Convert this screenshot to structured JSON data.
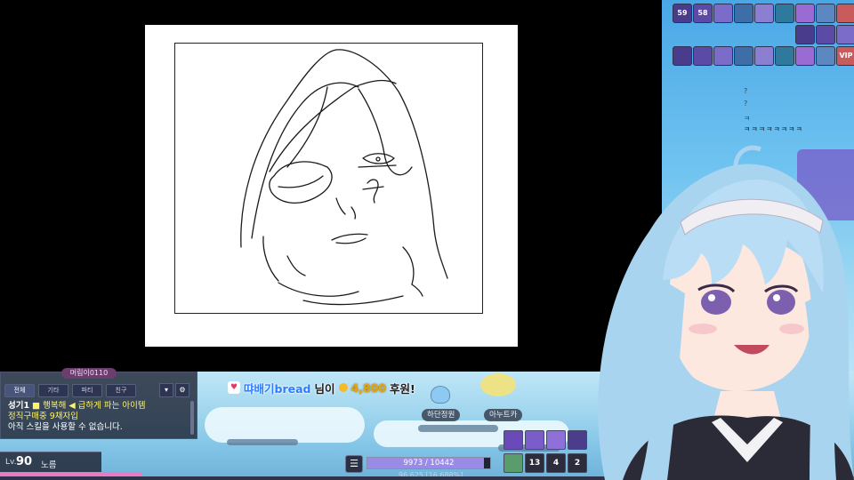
{
  "canvas": {
    "background": "#ffffff",
    "stroke": "#1a1a1a"
  },
  "chat": {
    "title": "머림이0110",
    "tabs": [
      "전체",
      "기타",
      "파티",
      "친구"
    ],
    "dropdown_icon": "chevron-down-icon",
    "settings_icon": "gear-icon",
    "lines": [
      {
        "name": "성기1",
        "text": "■ 행복해 ◀ 급하게 파는 아이템"
      },
      {
        "text": "정직구매중 9채자입"
      },
      {
        "text": "아직 스킬을 사용할 수 없습니다."
      }
    ]
  },
  "level": {
    "label": "Lv.",
    "value": "90",
    "job": "노름"
  },
  "donation": {
    "name": "땨배기bread",
    "suffix": "님이",
    "amount": "4,800",
    "word": "후원!"
  },
  "npcs": [
    "하단정원",
    "아누트카"
  ],
  "status": {
    "menu_icon": "menu-icon",
    "hp_text": "9973 / 10442",
    "hp_fraction": 0.95,
    "exp_text": "96.625 [16.688%]"
  },
  "quickslots": [
    "",
    "",
    "",
    "",
    "",
    "13",
    "4",
    "2"
  ],
  "buffs_row1": [
    "59",
    "58",
    "",
    "",
    "",
    "",
    "",
    "",
    ""
  ],
  "buffs_row2": [
    "",
    "",
    "",
    "",
    "",
    "",
    "",
    "",
    ""
  ],
  "buffs_row3": [
    "",
    "",
    "",
    "",
    "",
    "",
    "",
    "",
    "VIP"
  ],
  "side_text": {
    "q": "?",
    "p": "?",
    "k": "ㅋ",
    "laugh": "ㅋㅋㅋㅋㅋㅋㅋㅋ"
  },
  "colors": {
    "chat_bg": "#1e2333",
    "megaphone": "#fff36b",
    "donation_name": "#2c7cff",
    "donation_amount": "#e5a70c",
    "hp_fill": "#9a8ce6",
    "hair": "#a9d4f0"
  }
}
